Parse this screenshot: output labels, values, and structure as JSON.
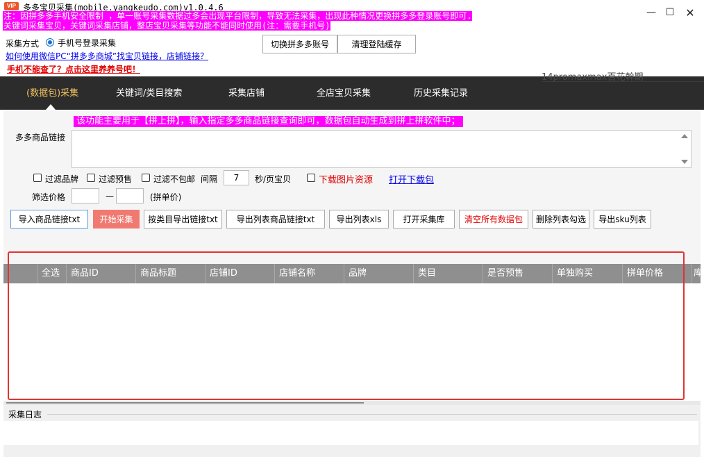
{
  "window": {
    "badge": "VIP",
    "title": "多多宝贝采集(mobile.yangkeudo.com)v1.0.4.6",
    "notice1": "注：因拼多多手机安全限制 ，单一账号采集数据过多会出现平台限制，导致无法采集，出现此种情况更换拼多多登录账号即可.",
    "notice2": "关键词采集宝贝，关键词采集店铺，整店宝贝采集等功能不能同时使用(注：需要手机号)",
    "min_icon": "—",
    "max_icon": "☐",
    "close_icon": "✕"
  },
  "settings": {
    "mode_label": "采集方式",
    "mode_option": "手机号登录采集",
    "howto_link": "如何使用微信PC“拼多多商城”找宝贝链接，店铺链接？",
    "phone_link": "手机不能查了？点击这里养养号吧！",
    "switch_account": "切换拼多多账号",
    "clear_cache": "清理登陆缓存"
  },
  "nav": {
    "ghost_text": "14promaxmax百花幹期",
    "tabs": [
      {
        "label": "(数据包)采集",
        "active": true
      },
      {
        "label": "关键词/类目搜索",
        "active": false
      },
      {
        "label": "采集店铺",
        "active": false
      },
      {
        "label": "全店宝贝采集",
        "active": false
      },
      {
        "label": "历史采集记录",
        "active": false
      }
    ]
  },
  "form": {
    "func_notice": "该功能主要用于【拼上拼】，输入指定多多商品链接查询即可，数据包自动生成到拼上拼软件中；",
    "link_label": "多多商品链接",
    "link_value": "",
    "filter_brand": "过滤品牌",
    "filter_presale": "过滤预售",
    "filter_no_shipping": "过滤不包邮",
    "interval_label": "间隔",
    "interval_value": "7",
    "interval_unit": "秒/页宝贝",
    "download_images": "下载图片资源",
    "open_download": "打开下载包",
    "price_label": "筛选价格",
    "price_dash": "—",
    "price_note": "(拼单价)"
  },
  "actions": {
    "import_links": "导入商品链接txt",
    "start": "开始采集",
    "export_by_category": "按类目导出链接txt",
    "export_list_links": "导出列表商品链接txt",
    "export_xls": "导出列表xls",
    "open_library": "打开采集库",
    "clear_all": "清空所有数据包",
    "delete_checked": "删除列表勾选",
    "export_sku": "导出sku列表"
  },
  "table": {
    "columns": [
      "全选",
      "商品ID",
      "商品标题",
      "店铺ID",
      "店铺名称",
      "品牌",
      "类目",
      "是否预售",
      "单独购买",
      "拼单价格",
      "库"
    ]
  },
  "log": {
    "label": "采集日志"
  },
  "colors": {
    "notice_bg": "#ff00ff",
    "nav_bg": "#2c2c2c",
    "active_tab": "#f0c060",
    "start_btn": "#f07a72",
    "frame": "#e23232"
  }
}
